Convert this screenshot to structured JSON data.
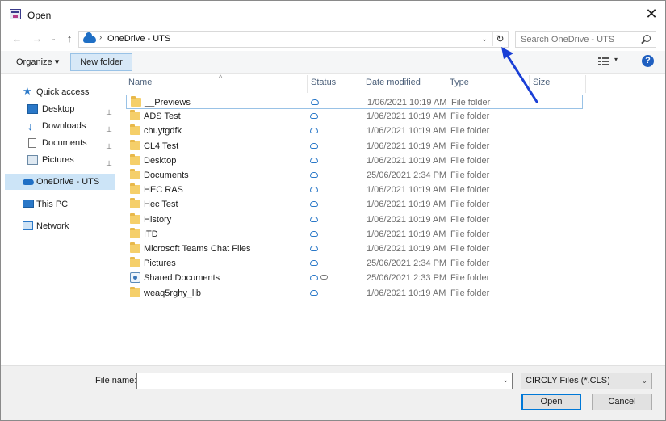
{
  "window": {
    "title": "Open",
    "close_glyph": "✕"
  },
  "nav": {
    "back_glyph": "←",
    "forward_glyph": "→",
    "recent_glyph": "⌄",
    "up_glyph": "↑"
  },
  "address": {
    "location_icon": "cloud-icon",
    "separator": "›",
    "crumb": "OneDrive - UTS",
    "dropdown_glyph": "⌄",
    "refresh_glyph": "↻"
  },
  "search": {
    "placeholder": "Search OneDrive - UTS"
  },
  "toolbar": {
    "organize_label": "Organize ▾",
    "new_folder_label": "New folder",
    "view_dd_glyph": "▾",
    "help_glyph": "?"
  },
  "sidebar": {
    "items": [
      {
        "label": "Quick access",
        "icon": "star-icon"
      },
      {
        "label": "Desktop",
        "icon": "desktop-icon",
        "pinned": true
      },
      {
        "label": "Downloads",
        "icon": "download-icon",
        "pinned": true
      },
      {
        "label": "Documents",
        "icon": "documents-icon",
        "pinned": true
      },
      {
        "label": "Pictures",
        "icon": "pictures-icon",
        "pinned": true
      },
      {
        "label": "OneDrive - UTS",
        "icon": "cloud-icon",
        "selected": true
      },
      {
        "label": "This PC",
        "icon": "computer-icon"
      },
      {
        "label": "Network",
        "icon": "network-icon"
      }
    ],
    "pin_glyph": "📌"
  },
  "columns": {
    "name": "Name",
    "status": "Status",
    "date": "Date modified",
    "type": "Type",
    "size": "Size",
    "sort_glyph": "^"
  },
  "files": [
    {
      "name": "__Previews",
      "date": "1/06/2021 10:19 AM",
      "type": "File folder"
    },
    {
      "name": "ADS Test",
      "date": "1/06/2021 10:19 AM",
      "type": "File folder"
    },
    {
      "name": "chuytgdfk",
      "date": "1/06/2021 10:19 AM",
      "type": "File folder"
    },
    {
      "name": "CL4 Test",
      "date": "1/06/2021 10:19 AM",
      "type": "File folder"
    },
    {
      "name": "Desktop",
      "date": "1/06/2021 10:19 AM",
      "type": "File folder"
    },
    {
      "name": "Documents",
      "date": "25/06/2021 2:34 PM",
      "type": "File folder"
    },
    {
      "name": "HEC RAS",
      "date": "1/06/2021 10:19 AM",
      "type": "File folder"
    },
    {
      "name": "Hec Test",
      "date": "1/06/2021 10:19 AM",
      "type": "File folder"
    },
    {
      "name": "History",
      "date": "1/06/2021 10:19 AM",
      "type": "File folder"
    },
    {
      "name": "ITD",
      "date": "1/06/2021 10:19 AM",
      "type": "File folder"
    },
    {
      "name": "Microsoft Teams Chat Files",
      "date": "1/06/2021 10:19 AM",
      "type": "File folder"
    },
    {
      "name": "Pictures",
      "date": "25/06/2021 2:34 PM",
      "type": "File folder"
    },
    {
      "name": "Shared Documents",
      "date": "25/06/2021 2:33 PM",
      "type": "File folder",
      "shared": true
    },
    {
      "name": "weaq5rghy_lib",
      "date": "1/06/2021 10:19 AM",
      "type": "File folder"
    }
  ],
  "bottom": {
    "filename_label": "File name:",
    "filename_value": "",
    "dd_glyph": "⌄",
    "filter_value": "CIRCLY Files (*.CLS)",
    "open_label": "Open",
    "cancel_label": "Cancel"
  },
  "annotation": {
    "arrow_color": "#1a3fd6"
  }
}
